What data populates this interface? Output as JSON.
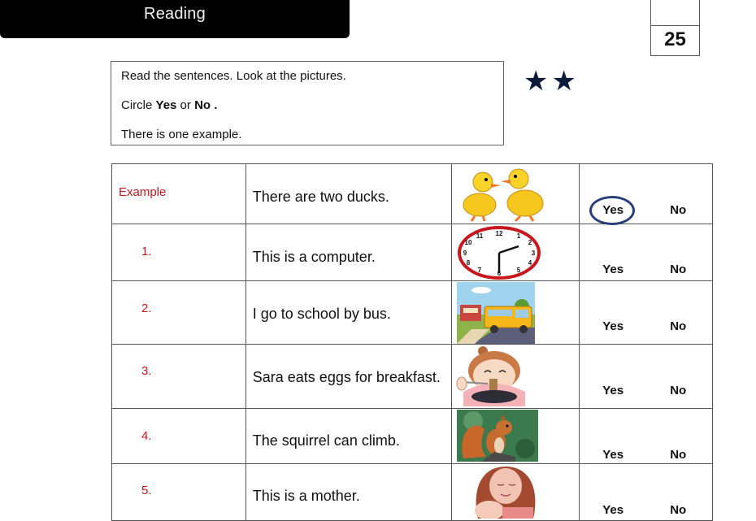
{
  "header": {
    "title": "Reading",
    "score": "25"
  },
  "instructions": {
    "line1": "Read the sentences. Look at the pictures.",
    "line2_prefix": "Circle ",
    "line2_yes": "Yes",
    "line2_or": " or ",
    "line2_no": "No .",
    "line3": "There is one example.",
    "stars": "★★",
    "star_color": "#0e1a3a"
  },
  "options": {
    "yes": "Yes",
    "no": "No"
  },
  "rows": [
    {
      "number": "Example",
      "sentence": "There are two ducks.",
      "picture": "two-ducks",
      "circled": "Yes"
    },
    {
      "number": "1.",
      "sentence": "This is a computer.",
      "picture": "clock",
      "circled": null
    },
    {
      "number": "2.",
      "sentence": "I go to school by bus.",
      "picture": "school-bus",
      "circled": null
    },
    {
      "number": "3.",
      "sentence": "Sara eats eggs for breakfast.",
      "picture": "girl-eating-noodles",
      "circled": null
    },
    {
      "number": "4.",
      "sentence": "The squirrel can climb.",
      "picture": "squirrel",
      "circled": null
    },
    {
      "number": "5.",
      "sentence": "This is a mother.",
      "picture": "mother-and-baby",
      "circled": null
    }
  ],
  "colors": {
    "number_red": "#c8181e",
    "circle_blue": "#2a3f7a"
  }
}
